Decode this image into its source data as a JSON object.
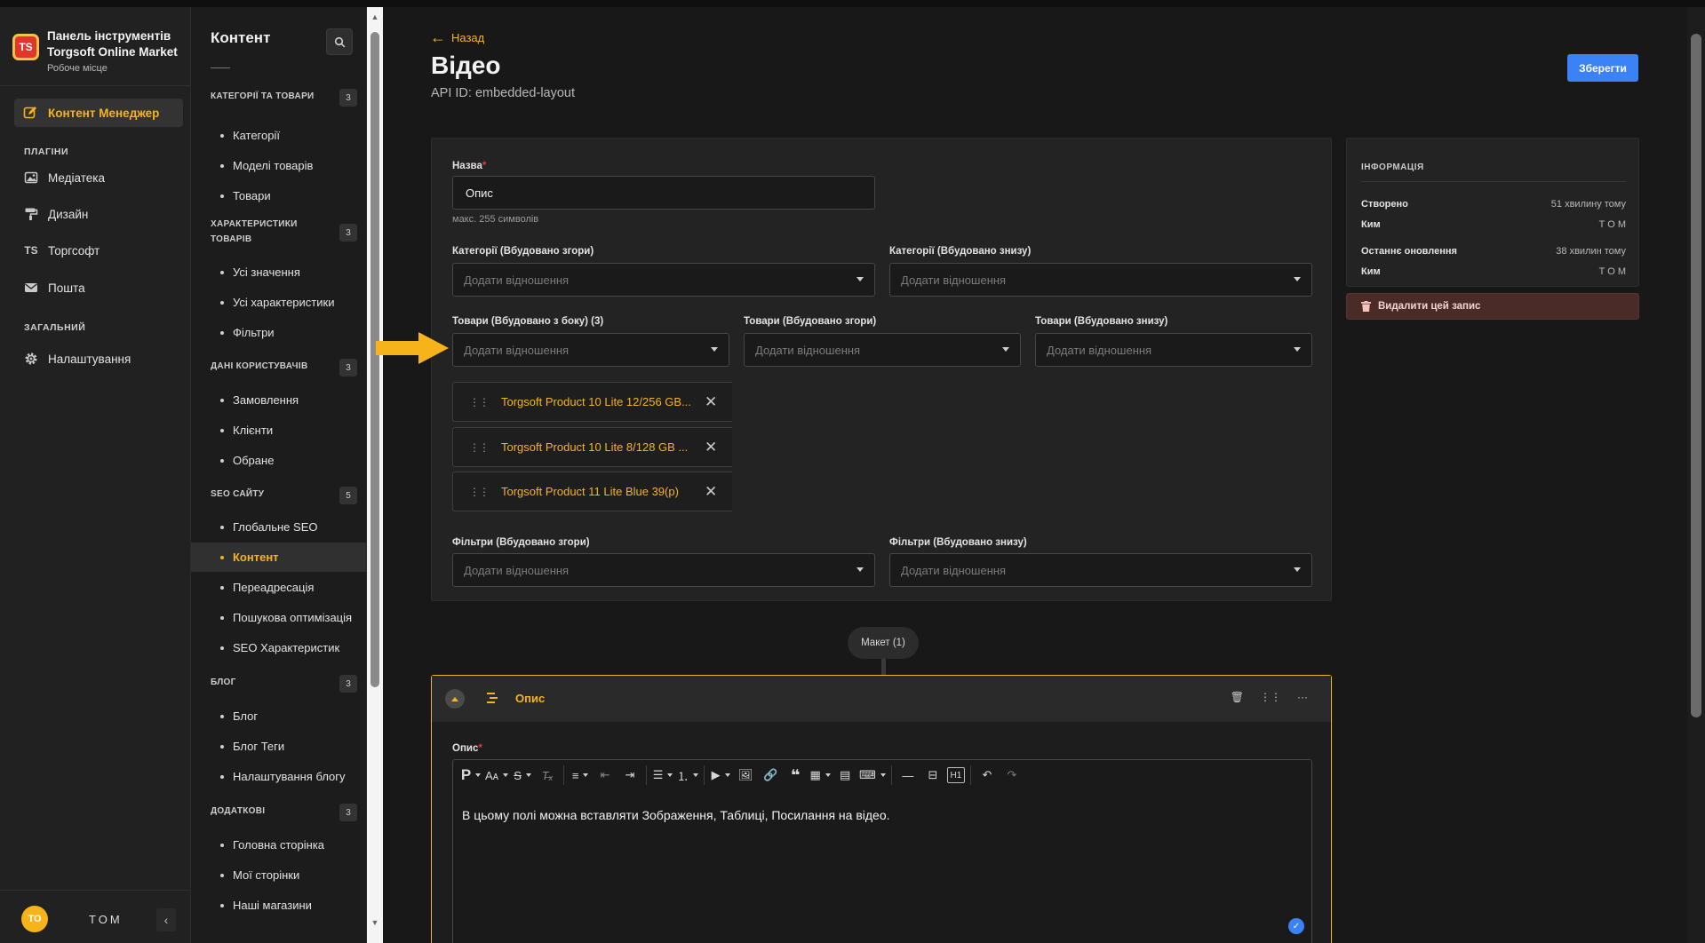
{
  "brand": {
    "title": "Панель інструментів Torgsoft Online Market",
    "subtitle": "Робоче місце",
    "logo_text": "TS"
  },
  "nav": {
    "active": "Контент Менеджер",
    "sections": {
      "plugins": "ПЛАГІНИ",
      "general": "ЗАГАЛЬНИЙ"
    },
    "items": {
      "media": "Медіатека",
      "design": "Дизайн",
      "torgsoft": "Торгсофт",
      "mail": "Пошта",
      "settings": "Налаштування"
    },
    "torgsoft_icon_text": "TS"
  },
  "user": {
    "initials": "TO",
    "name": "TOM"
  },
  "content_nav": {
    "title": "Контент",
    "groups": [
      {
        "label": "КАТЕГОРІЇ ТА ТОВАРИ",
        "count": "3",
        "items": [
          "Категорії",
          "Моделі товарів",
          "Товари"
        ]
      },
      {
        "label": "ХАРАКТЕРИСТИКИ ТОВАРІВ",
        "count": "3",
        "items": [
          "Усі значення",
          "Усі характеристики",
          "Фільтри"
        ]
      },
      {
        "label": "ДАНІ КОРИСТУВАЧІВ",
        "count": "3",
        "items": [
          "Замовлення",
          "Клієнти",
          "Обране"
        ]
      },
      {
        "label": "SEO САЙТУ",
        "count": "5",
        "items": [
          "Глобальне SEO",
          "Контент",
          "Переадресація",
          "Пошукова оптимізація",
          "SEO Характеристик"
        ]
      },
      {
        "label": "БЛОГ",
        "count": "3",
        "items": [
          "Блог",
          "Блог Теги",
          "Налаштування блогу"
        ]
      },
      {
        "label": "ДОДАТКОВІ",
        "count": "3",
        "items": [
          "Головна сторінка",
          "Мої сторінки",
          "Наші магазини"
        ]
      }
    ]
  },
  "header": {
    "back": "Назад",
    "title": "Відео",
    "api_id": "API ID: embedded-layout",
    "save": "Зберегти"
  },
  "form": {
    "name_label": "Назва",
    "name_value": "Опис",
    "name_hint": "макс. 255 символів",
    "placeholder": "Додати відношення",
    "cat_top": "Категорії (Вбудовано згори)",
    "cat_bottom": "Категорії (Вбудовано знизу)",
    "prod_side": "Товари (Вбудовано з боку) (3)",
    "prod_top": "Товари (Вбудовано згори)",
    "prod_bottom": "Товари (Вбудовано знизу)",
    "relations": [
      "Torgsoft Product 10 Lite 12/256 GB...",
      "Torgsoft Product 10 Lite 8/128 GB ...",
      "Torgsoft Product 11 Lite Blue 39(p)"
    ],
    "filt_top": "Фільтри (Вбудовано згори)",
    "filt_bottom": "Фільтри (Вбудовано знизу)"
  },
  "info": {
    "heading": "ІНФОРМАЦІЯ",
    "created_label": "Створено",
    "created_value": "51 хвилину тому",
    "by_label": "Ким",
    "by_value": "T O M",
    "updated_label": "Останнє оновлення",
    "updated_value": "38 хвилин тому",
    "by2_label": "Ким",
    "by2_value": "T O M",
    "delete": "Видалити цей запис"
  },
  "dynamic_zone": {
    "pill": "Макет (1)",
    "component_title": "Опис",
    "editor_label": "Опис",
    "editor_text": "В цьому полі можна вставляти Зображення, Таблиці, Посилання на відео."
  },
  "colors": {
    "accent": "#f6b41a",
    "primary": "#3b82f6",
    "danger_bg": "#4a2b28"
  }
}
